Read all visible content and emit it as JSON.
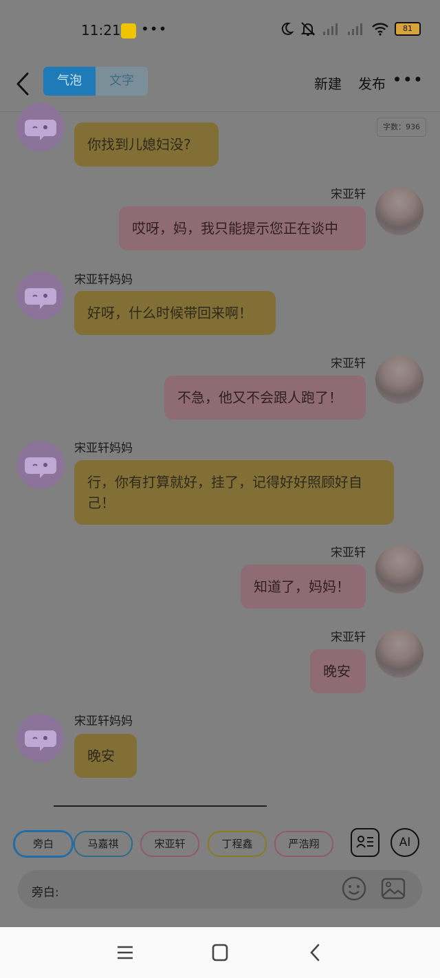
{
  "status_bar": {
    "time": "11:21",
    "dots": "•••",
    "battery": "81"
  },
  "header": {
    "tabs": [
      {
        "label": "气泡",
        "active": true
      },
      {
        "label": "文字",
        "active": false
      }
    ],
    "new_label": "新建",
    "publish_label": "发布",
    "more_label": "•••"
  },
  "word_count": "字数：936",
  "messages": [
    {
      "side": "left",
      "speaker": "",
      "text": "你找到儿媳妇没?"
    },
    {
      "side": "right",
      "speaker": "宋亚轩",
      "text": "哎呀，妈，我只能提示您正在谈中"
    },
    {
      "side": "left",
      "speaker": "宋亚轩妈妈",
      "text": "好呀，什么时候带回来啊！"
    },
    {
      "side": "right",
      "speaker": "宋亚轩",
      "text": "不急，他又不会跟人跑了！"
    },
    {
      "side": "left",
      "speaker": "宋亚轩妈妈",
      "text": "行，你有打算就好，挂了，记得好好照顾好自己！"
    },
    {
      "side": "right",
      "speaker": "宋亚轩",
      "text": "知道了，妈妈！"
    },
    {
      "side": "right",
      "speaker": "宋亚轩",
      "text": "晚安"
    },
    {
      "side": "left",
      "speaker": "宋亚轩妈妈",
      "text": "晚安"
    }
  ],
  "roles": [
    "旁白",
    "马嘉祺",
    "宋亚轩",
    "丁程鑫",
    "严浩翔"
  ],
  "ai_label": "AI",
  "input": {
    "label": "旁白:"
  },
  "colors": {
    "left_bubble": "#816f36",
    "right_bubble": "#8f6c75",
    "active_tab": "#1f7ab8",
    "overlay": "#808080"
  },
  "icons": [
    "back-arrow-icon",
    "contact-card-icon",
    "emoji-icon",
    "image-icon",
    "menu-icon",
    "home-square-icon",
    "back-chevron-icon"
  ]
}
